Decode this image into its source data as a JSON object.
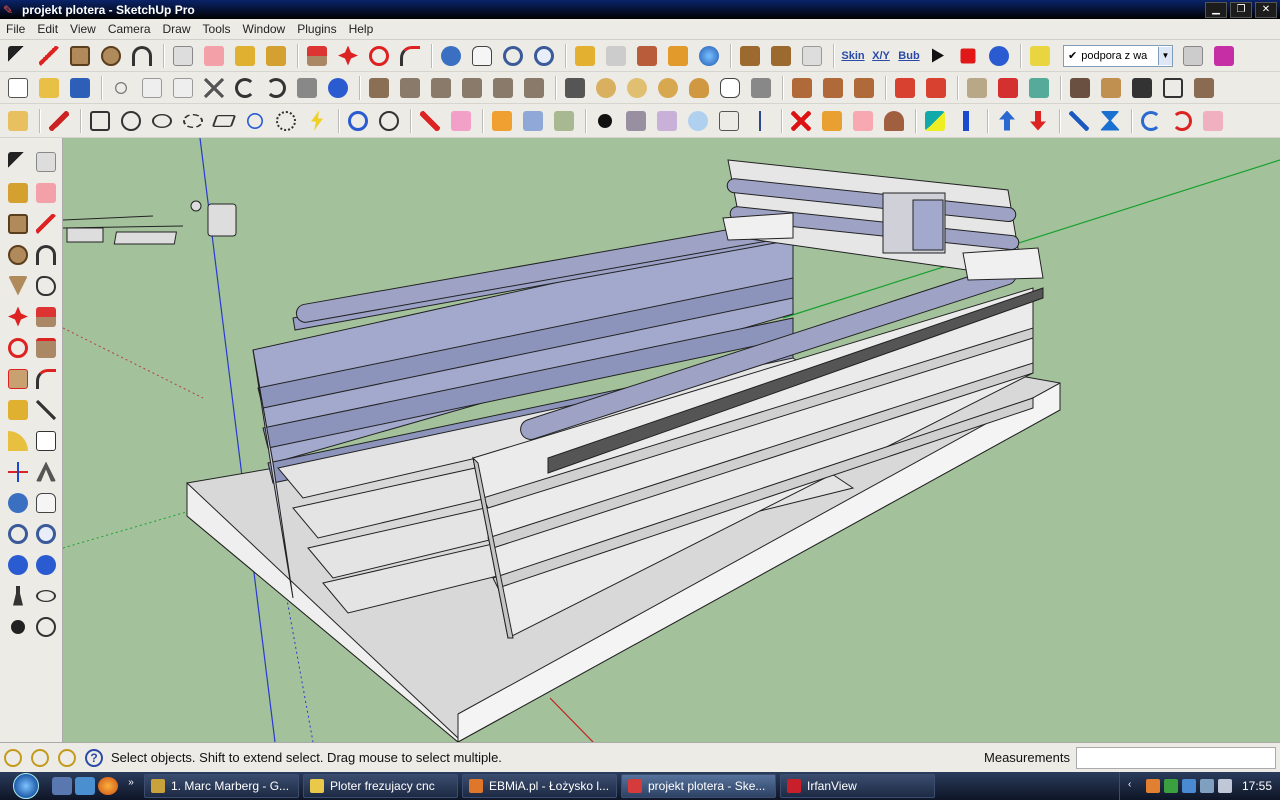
{
  "window": {
    "title": "projekt plotera - SketchUp Pro",
    "icon": "sketchup-icon"
  },
  "menu": [
    "File",
    "Edit",
    "View",
    "Camera",
    "Draw",
    "Tools",
    "Window",
    "Plugins",
    "Help"
  ],
  "toolbar1": {
    "skin_label": "Skin",
    "xyz_label": "X/Y",
    "bub_label": "Bub",
    "layer_value": "podpora z wa",
    "layer_checked": "✔"
  },
  "status": {
    "text": "Select objects. Shift to extend select. Drag mouse to select multiple.",
    "measurements_label": "Measurements"
  },
  "taskbar": {
    "tasks": [
      {
        "label": "1. Marc Marberg - G...",
        "icon_color": "#c9a23c",
        "active": false
      },
      {
        "label": "Ploter frezujacy cnc",
        "icon_color": "#e9c84a",
        "active": false
      },
      {
        "label": "EBMiA.pl - Łożysko l...",
        "icon_color": "#e0762a",
        "active": false
      },
      {
        "label": "projekt plotera - Ske...",
        "icon_color": "#d63b3b",
        "active": true
      },
      {
        "label": "IrfanView",
        "icon_color": "#c8202a",
        "active": false
      }
    ],
    "time": "17:55"
  },
  "colors": {
    "viewport_bg": "#a3c29b",
    "profile": "#9ea3c6",
    "aluminium": "#e8e8e8",
    "base": "#c8c8c8"
  }
}
